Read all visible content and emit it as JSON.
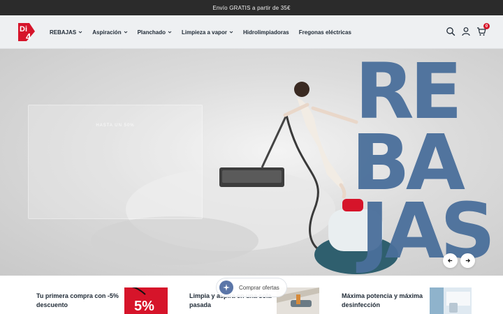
{
  "announcement": {
    "text": "Envío GRATIS a partir de 35€"
  },
  "brand": {
    "logo_text": "Di4",
    "accent": "#d6142a"
  },
  "nav": {
    "items": [
      {
        "label": "REBAJAS",
        "has_dropdown": true
      },
      {
        "label": "Aspiración",
        "has_dropdown": true
      },
      {
        "label": "Planchado",
        "has_dropdown": true
      },
      {
        "label": "Limpieza a vapor",
        "has_dropdown": true
      },
      {
        "label": "Hidrolimpiadoras",
        "has_dropdown": false
      },
      {
        "label": "Fregonas eléctricas",
        "has_dropdown": false
      }
    ]
  },
  "header_icons": {
    "search": "search-icon",
    "account": "user-icon",
    "cart": "cart-icon",
    "cart_count": "0"
  },
  "hero": {
    "subtitle": "HASTA UN 50%",
    "headline_lines": [
      "RE",
      "BA",
      "JAS"
    ],
    "headline_color": "#4a6f9b"
  },
  "features": [
    {
      "title": "Tu primera compra con -5% descuento",
      "badge": "5%"
    },
    {
      "title": "Limpia y aspira en una sola pasada"
    },
    {
      "title": "Máxima potencia y máxima desinfección"
    }
  ],
  "floating_chip": {
    "label": "Comprar ofertas",
    "icon": "sparkle-icon"
  }
}
